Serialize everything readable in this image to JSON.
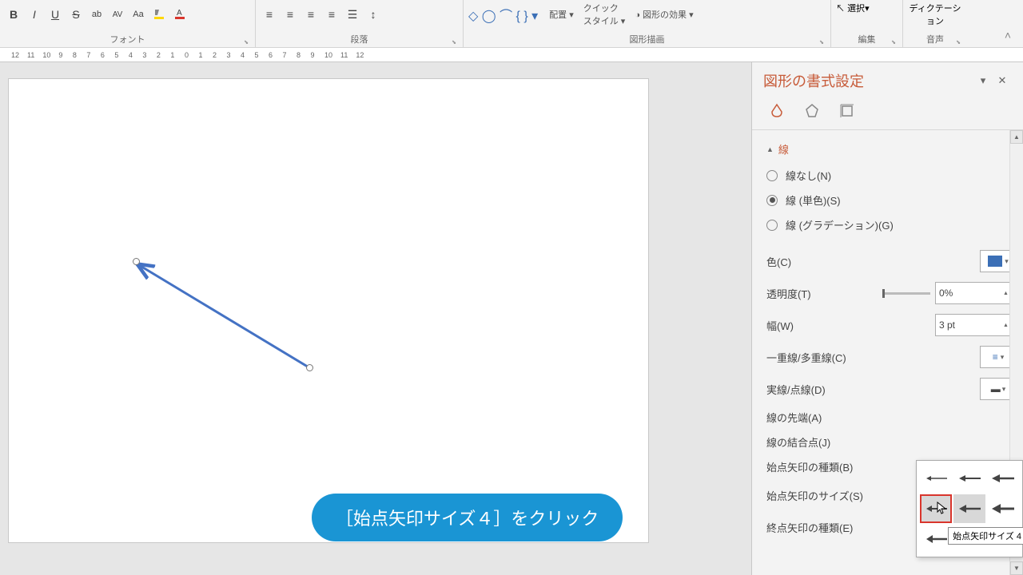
{
  "ribbon": {
    "groups": {
      "font": "フォント",
      "paragraph": "段落",
      "drawing": "図形描画",
      "edit": "編集",
      "voice": "音声"
    },
    "effects": "図形の効果",
    "select": "選択",
    "dictation": "ディクテーション"
  },
  "ruler": "12    11    10    9     8     7     6     5     4     3     2     1     0     1     2     3     4     5     6     7     8     9     10    11    12",
  "pane": {
    "title": "図形の書式設定",
    "section": "線",
    "line_none": "線なし(N)",
    "line_solid": "線 (単色)(S)",
    "line_grad": "線 (グラデーション)(G)",
    "color": "色(C)",
    "transparency": "透明度(T)",
    "transparency_val": "0%",
    "width": "幅(W)",
    "width_val": "3 pt",
    "compound": "一重線/多重線(C)",
    "dash": "実線/点線(D)",
    "cap": "線の先端(A)",
    "join": "線の結合点(J)",
    "begin_type": "始点矢印の種類(B)",
    "begin_size": "始点矢印のサイズ(S)",
    "end_type": "終点矢印の種類(E)"
  },
  "tooltip": "始点矢印サイズ 4",
  "bubble": "［始点矢印サイズ４］をクリック"
}
